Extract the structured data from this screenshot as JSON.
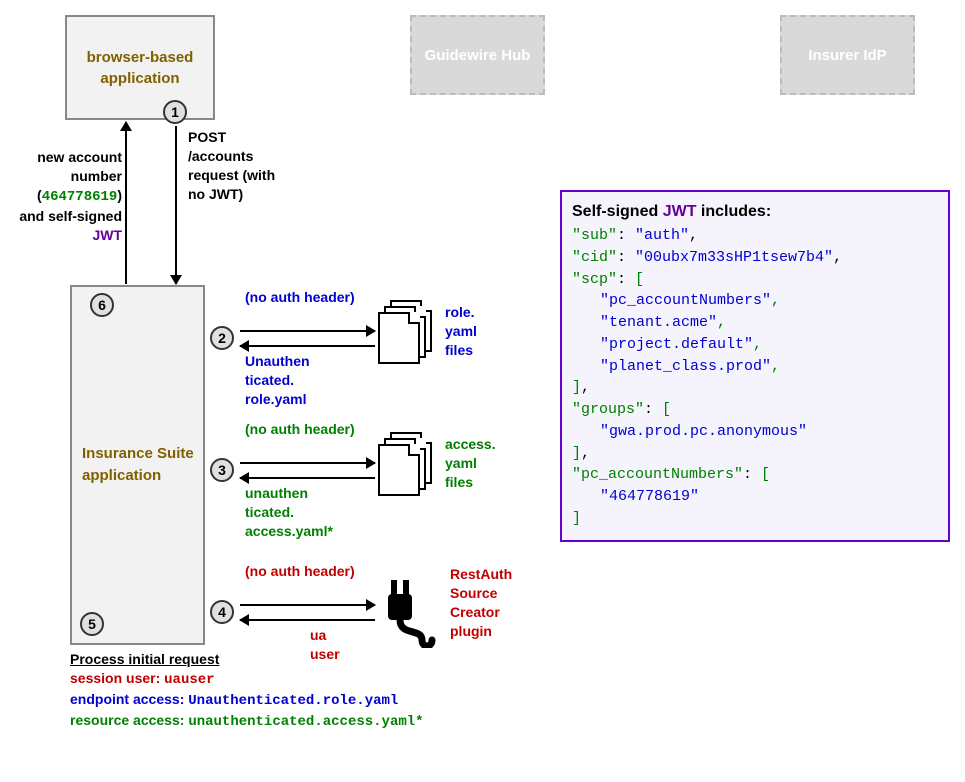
{
  "boxes": {
    "browser": "browser-based application",
    "hub": "Guidewire Hub",
    "idp": "Insurer IdP",
    "is_app": "Insurance Suite application"
  },
  "nums": {
    "n1": "1",
    "n2": "2",
    "n3": "3",
    "n4": "4",
    "n5": "5",
    "n6": "6"
  },
  "post_label_line1": "POST",
  "post_label_line2": "/accounts request (with no JWT)",
  "return_label_pre": "new account number (",
  "return_acct": "464778619",
  "return_label_mid": ") and self-signed ",
  "return_jwt": "JWT",
  "step2_top": "(no auth header)",
  "step2_bot": "Unauthen\nticated.\nrole.yaml",
  "step2_right": "role.\nyaml\nfiles",
  "step3_top": "(no auth header)",
  "step3_bot": "unauthen\nticated.\naccess.yaml*",
  "step3_right": "access.\nyaml\nfiles",
  "step4_top": "(no auth header)",
  "step4_bot": "ua\nuser",
  "step4_right": "RestAuth\nSource\nCreator\nplugin",
  "footer_title": "Process initial request",
  "footer_l1a": "session user: ",
  "footer_l1b": "uauser",
  "footer_l2a": "endpoint access: ",
  "footer_l2b": "Unauthenticated.role.yaml",
  "footer_l3a": "resource access: ",
  "footer_l3b": "unauthenticated.access.yaml*",
  "jwt": {
    "title_a": "Self-signed ",
    "title_jwt": "JWT",
    "title_b": " includes:",
    "sub_k": "\"sub\"",
    "sub_v": "\"auth\"",
    "cid_k": "\"cid\"",
    "cid_v": "\"00ubx7m33sHP1tsew7b4\"",
    "scp_k": "\"scp\"",
    "scp_items": [
      "\"pc_accountNumbers\"",
      "\"tenant.acme\"",
      "\"project.default\"",
      "\"planet_class.prod\""
    ],
    "groups_k": "\"groups\"",
    "groups_items": [
      "\"gwa.prod.pc.anonymous\""
    ],
    "pcacct_k": "\"pc_accountNumbers\"",
    "pcacct_items": [
      "\"464778619\""
    ]
  }
}
